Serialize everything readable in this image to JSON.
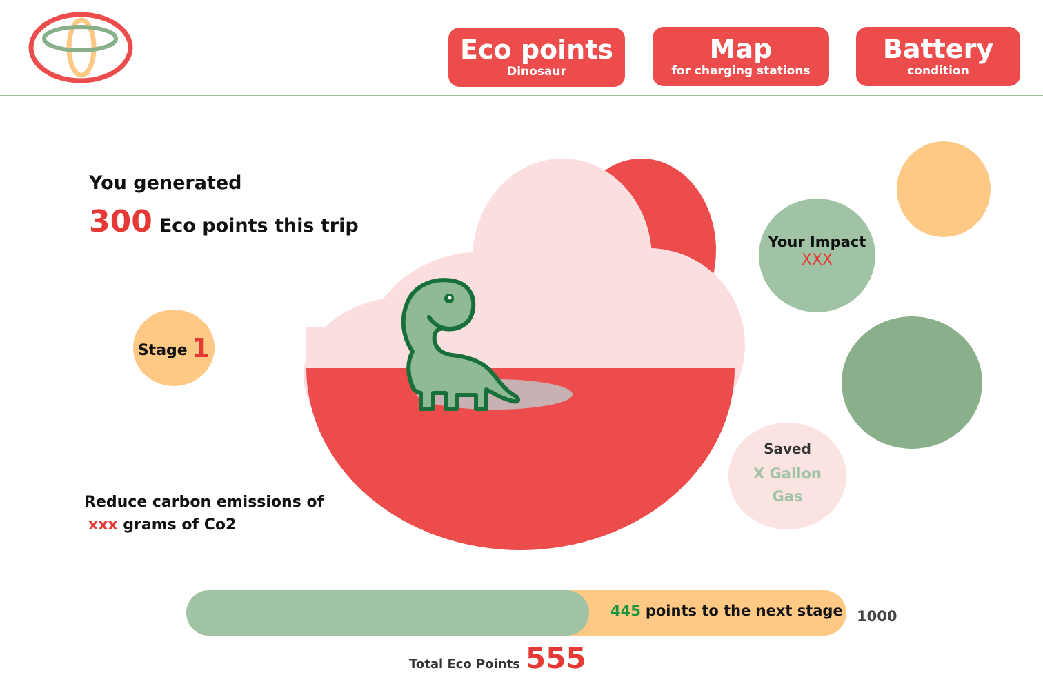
{
  "header": {
    "logo_icon": "ring-logo-icon",
    "nav": [
      {
        "title": "Eco points",
        "subtitle": "Dinosaur"
      },
      {
        "title": "Map",
        "subtitle": "for charging stations"
      },
      {
        "title": "Battery",
        "subtitle": "condition"
      }
    ]
  },
  "summary": {
    "generated_label": "You generated",
    "trip_points": "300",
    "trip_suffix": "Eco points this trip"
  },
  "stage": {
    "label": "Stage",
    "number": "1"
  },
  "reduce": {
    "line1": "Reduce carbon emissions of",
    "value": "xxx",
    "line2_suffix": "grams of Co2"
  },
  "scene": {
    "icon": "dinosaur-icon"
  },
  "impact": {
    "title": "Your Impact",
    "value": "XXX"
  },
  "saved": {
    "title": "Saved",
    "value": "X Gallon Gas"
  },
  "progress": {
    "remaining": "445",
    "remaining_text": "points to the next stage",
    "max": "1000",
    "fraction": 0.61
  },
  "total": {
    "label": "Total Eco Points",
    "value": "555"
  },
  "colors": {
    "red": "#ec4c4b",
    "accent_red": "#e53935",
    "pink": "#fbdfe0",
    "orange": "#fec985",
    "sage": "#a0c3a5",
    "green": "#8aaf8b",
    "dark_green": "#17943e"
  }
}
